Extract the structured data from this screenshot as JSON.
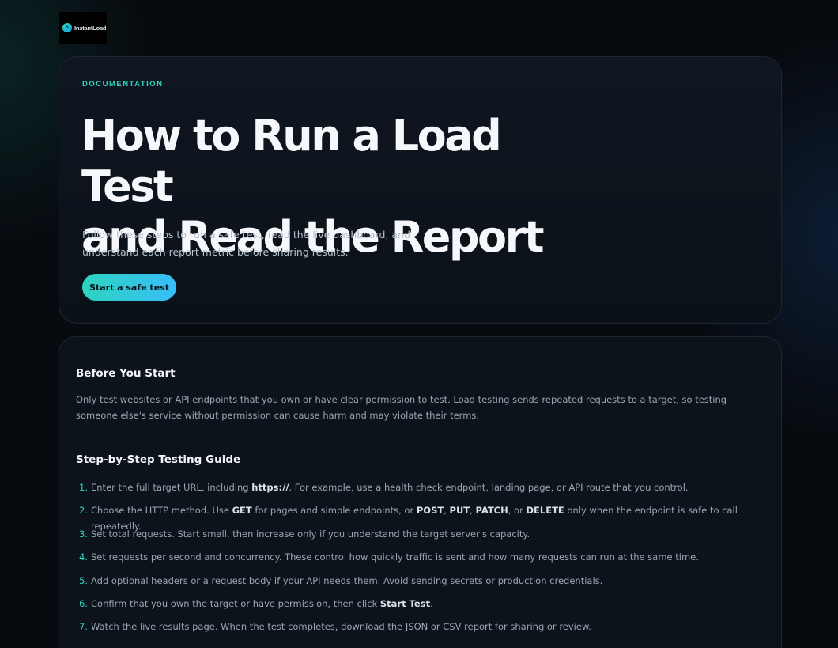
{
  "brand": {
    "name": "InstantLoad"
  },
  "hero": {
    "eyebrow": "DOCUMENTATION",
    "title_line1": "How to Run a Load Test",
    "title_line2": "and Read the Report",
    "description": "Follow these steps to run a safe test, read the live dashboard, and understand each report metric before sharing results.",
    "cta_label": "Start a safe test"
  },
  "before_start": {
    "title": "Before You Start",
    "text": "Only test websites or API endpoints that you own or have clear permission to test. Load testing sends repeated requests to a target, so testing someone else's service without permission can cause harm and may violate their terms."
  },
  "guide": {
    "title": "Step-by-Step Testing Guide",
    "steps": [
      {
        "number": "1.",
        "parts": [
          {
            "t": "Enter the full target URL, including "
          },
          {
            "t": "https://",
            "b": true
          },
          {
            "t": ". For example, use a health check endpoint, landing page, or API route that you control."
          }
        ]
      },
      {
        "number": "2.",
        "parts": [
          {
            "t": "Choose the HTTP method. Use "
          },
          {
            "t": "GET",
            "b": true
          },
          {
            "t": " for pages and simple endpoints, or "
          },
          {
            "t": "POST",
            "b": true
          },
          {
            "t": ", "
          },
          {
            "t": "PUT",
            "b": true
          },
          {
            "t": ", "
          },
          {
            "t": "PATCH",
            "b": true
          },
          {
            "t": ", or "
          },
          {
            "t": "DELETE",
            "b": true
          },
          {
            "t": " only when the endpoint is safe to call repeatedly."
          }
        ]
      },
      {
        "number": "3.",
        "parts": [
          {
            "t": "Set total requests. Start small, then increase only if you understand the target server's capacity."
          }
        ]
      },
      {
        "number": "4.",
        "parts": [
          {
            "t": "Set requests per second and concurrency. These control how quickly traffic is sent and how many requests can run at the same time."
          }
        ]
      },
      {
        "number": "5.",
        "parts": [
          {
            "t": "Add optional headers or a request body if your API needs them. Avoid sending secrets or production credentials."
          }
        ]
      },
      {
        "number": "6.",
        "parts": [
          {
            "t": "Confirm that you own the target or have permission, then click "
          },
          {
            "t": "Start Test",
            "b": true
          },
          {
            "t": "."
          }
        ]
      },
      {
        "number": "7.",
        "parts": [
          {
            "t": "Watch the live results page. When the test completes, download the JSON or CSV report for sharing or review."
          }
        ]
      }
    ]
  }
}
